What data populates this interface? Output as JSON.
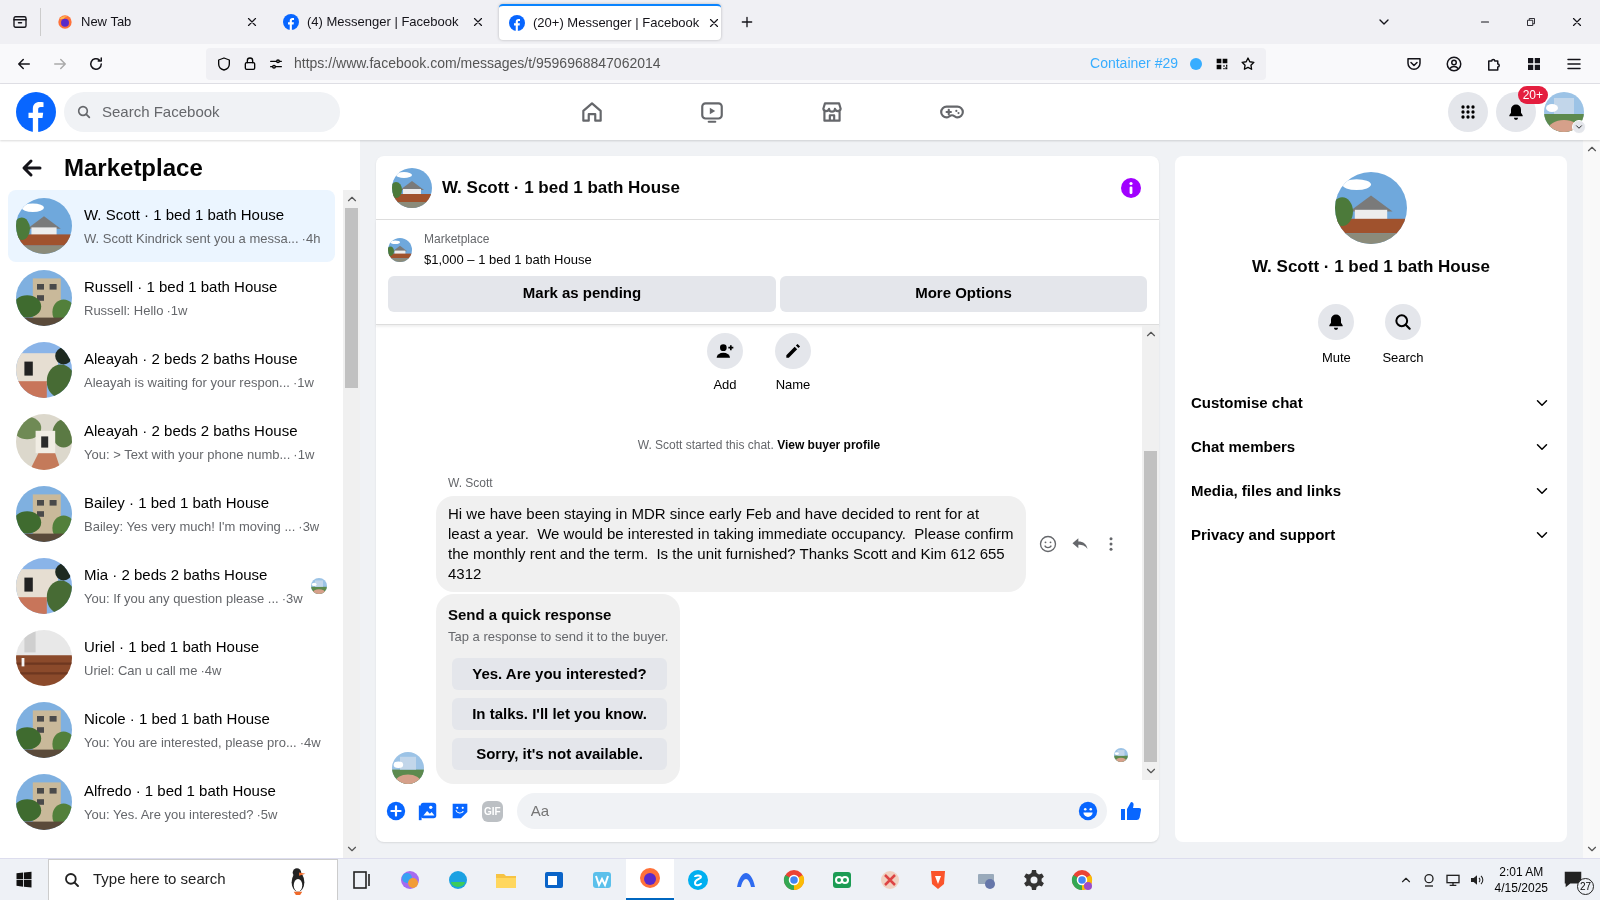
{
  "browser": {
    "tabs": [
      {
        "title": "New Tab",
        "selected": false,
        "kind": "firefox"
      },
      {
        "title": "(4) Messenger | Facebook",
        "selected": false,
        "kind": "facebook"
      },
      {
        "title": "(20+) Messenger | Facebook",
        "selected": true,
        "kind": "facebook"
      }
    ],
    "url": "https://www.facebook.com/messages/t/9596968847062014",
    "container": "Container #29"
  },
  "facebook": {
    "search_placeholder": "Search Facebook",
    "notification_count": "20+"
  },
  "sidebar": {
    "title": "Marketplace",
    "conversations": [
      {
        "name": "W. Scott · 1 bed 1 bath House",
        "preview": "W. Scott Kindrick sent you a messa...",
        "time": "·4h",
        "selected": true,
        "seen": false
      },
      {
        "name": "Russell · 1 bed 1 bath House",
        "preview": "Russell: Hello",
        "time": "·1w",
        "selected": false,
        "seen": false
      },
      {
        "name": "Aleayah · 2 beds 2 baths House",
        "preview": "Aleayah is waiting for your respon...",
        "time": "·1w",
        "selected": false,
        "seen": false
      },
      {
        "name": "Aleayah · 2 beds 2 baths House",
        "preview": "You: > Text with your phone numb...",
        "time": "·1w",
        "selected": false,
        "seen": false
      },
      {
        "name": "Bailey · 1 bed 1 bath House",
        "preview": "Bailey: Yes very much! I'm moving ...",
        "time": "·3w",
        "selected": false,
        "seen": false
      },
      {
        "name": "Mia · 2 beds 2 baths House",
        "preview": "You: If you any question please ...",
        "time": "·3w",
        "selected": false,
        "seen": true
      },
      {
        "name": "Uriel · 1 bed 1 bath House",
        "preview": "Uriel: Can u call me",
        "time": "·4w",
        "selected": false,
        "seen": false
      },
      {
        "name": "Nicole · 1 bed 1 bath House",
        "preview": "You: You are interested, please pro...",
        "time": "·4w",
        "selected": false,
        "seen": false
      },
      {
        "name": "Alfredo · 1 bed 1 bath House",
        "preview": "You: Yes. Are you interested?",
        "time": "·5w",
        "selected": false,
        "seen": false
      }
    ]
  },
  "chat": {
    "title": "W. Scott · 1 bed 1 bath House",
    "listing": {
      "label": "Marketplace",
      "title": "$1,000 – 1 bed 1 bath House"
    },
    "buttons": [
      "Mark as pending",
      "More Options"
    ],
    "actions": [
      "Add",
      "Name"
    ],
    "started": "W. Scott started this chat.",
    "profile_link": "View buyer profile",
    "message": {
      "sender": "W. Scott",
      "text": "Hi we have been staying in MDR since early Feb and have decided to rent for at least a year.  We would be interested in taking immediate occupancy.  Please confirm the monthly rent and the term.  Is the unit furnished? Thanks Scott and Kim 612 655 4312"
    },
    "quick_response": {
      "title": "Send a quick response",
      "hint": "Tap a response to send it to the buyer.",
      "options": [
        "Yes. Are you interested?",
        "In talks. I'll let you know.",
        "Sorry, it's not available."
      ]
    },
    "composer": {
      "gif_label": "GIF",
      "placeholder": "Aa"
    }
  },
  "details": {
    "name": "W. Scott · 1 bed 1 bath House",
    "actions": [
      {
        "label": "Mute",
        "kind": "bell"
      },
      {
        "label": "Search",
        "kind": "search"
      }
    ],
    "sections": [
      {
        "label": "Customise chat",
        "expanded": false
      },
      {
        "label": "Chat members",
        "expanded": false
      },
      {
        "label": "Media, files and links",
        "expanded": false
      },
      {
        "label": "Privacy and support",
        "expanded": false
      }
    ]
  },
  "taskbar": {
    "search_placeholder": "Type here to search",
    "time": "2:01 AM",
    "date": "4/15/2025",
    "notification_count": "27"
  }
}
